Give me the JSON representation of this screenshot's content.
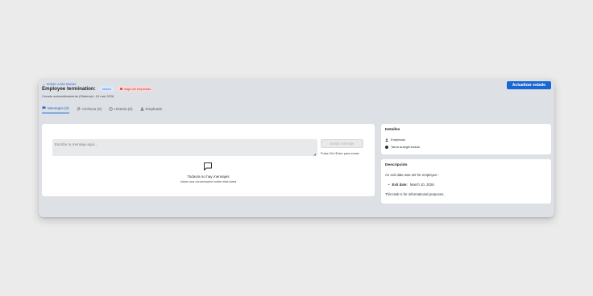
{
  "header": {
    "back_link": "Volver a las tareas",
    "title": "Employee termination:",
    "badge_status": "Nuevo",
    "badge_type": "Baja del empleado",
    "created": "Creado automáticamente (Sistema) • 10 mar 2026",
    "update_button": "Actualizar estado"
  },
  "tabs": [
    {
      "label": "Mensajes (0)",
      "icon": "flag-icon",
      "active": true
    },
    {
      "label": "Archivos (0)",
      "icon": "paperclip-icon",
      "active": false
    },
    {
      "label": "Historia (0)",
      "icon": "clock-icon",
      "active": false
    },
    {
      "label": "Empleado",
      "icon": "person-icon",
      "active": false
    }
  ],
  "messages": {
    "input_placeholder": "Escribe tu mensaje aquí...",
    "send_button": "Enviar mensaje",
    "send_hint": "Pulsa Ctrl+Enter para enviar",
    "empty_title": "Todavía no hay mensajes",
    "empty_subtitle": "Iniciar una conversación sobre esta tarea"
  },
  "details": {
    "title": "Detalles",
    "items": [
      {
        "icon": "person-icon",
        "label": "Empleado"
      },
      {
        "icon": "circle-icon",
        "label": "Tarea autogenerada"
      }
    ]
  },
  "description": {
    "title": "Descripción",
    "intro": "An exit date was set for employee :",
    "exit_label": "Exit date:",
    "exit_value": "March 10, 2026",
    "note": "This task is for informational purposes."
  },
  "colors": {
    "primary": "#1967d2",
    "danger": "#d93b3b",
    "panel_bg": "#dde0e4",
    "page_bg": "#ebebeb"
  }
}
